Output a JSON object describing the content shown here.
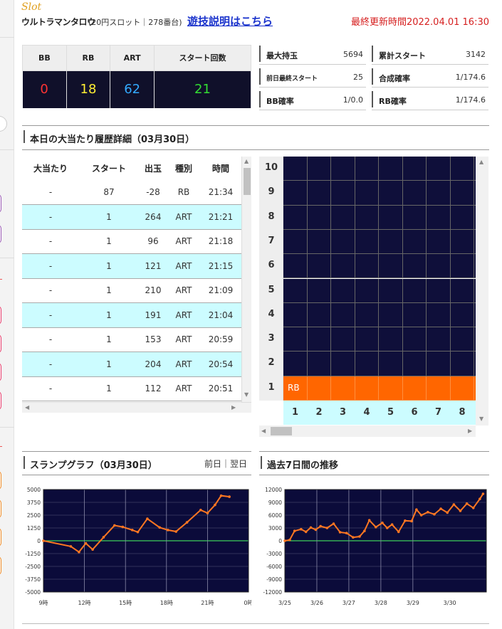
{
  "header": {
    "category": "Slot",
    "machine_name": "ウルトラマンタロウ",
    "subtitle": "(20円スロット｜278番台)",
    "rules_link": "遊技説明はこちら",
    "updated": "最終更新時間2022.04.01 16:30"
  },
  "counters": {
    "headers": [
      "BB",
      "RB",
      "ART",
      "スタート回数"
    ],
    "values": [
      "0",
      "18",
      "62",
      "21"
    ],
    "colors": [
      "#ff3333",
      "#ffee33",
      "#33aaff",
      "#33dd33"
    ]
  },
  "stats": [
    {
      "label": "最大持玉",
      "value": "5694"
    },
    {
      "label": "累計スタート",
      "value": "3142"
    },
    {
      "label": "前日最終スタート",
      "value": "25"
    },
    {
      "label": "合成確率",
      "value": "1/174.6"
    },
    {
      "label": "BB確率",
      "value": "1/0.0"
    },
    {
      "label": "RB確率",
      "value": "1/174.6"
    }
  ],
  "history": {
    "title": "本日の大当たり履歴詳細（03月30日）",
    "columns": [
      "大当たり",
      "スタート",
      "出玉",
      "種別",
      "時間"
    ],
    "rows": [
      [
        "-",
        "87",
        "-28",
        "RB",
        "21:34"
      ],
      [
        "-",
        "1",
        "264",
        "ART",
        "21:21"
      ],
      [
        "-",
        "1",
        "96",
        "ART",
        "21:18"
      ],
      [
        "-",
        "1",
        "121",
        "ART",
        "21:15"
      ],
      [
        "-",
        "1",
        "210",
        "ART",
        "21:09"
      ],
      [
        "-",
        "1",
        "191",
        "ART",
        "21:04"
      ],
      [
        "-",
        "1",
        "153",
        "ART",
        "20:59"
      ],
      [
        "-",
        "1",
        "204",
        "ART",
        "20:54"
      ],
      [
        "-",
        "1",
        "112",
        "ART",
        "20:51"
      ]
    ]
  },
  "hit_grid": {
    "y_labels": [
      "10",
      "9",
      "8",
      "7",
      "6",
      "5",
      "4",
      "3",
      "2",
      "1"
    ],
    "x_labels": [
      "1",
      "2",
      "3",
      "4",
      "5",
      "6",
      "7",
      "8"
    ],
    "hit_label": "RB",
    "hit_level": 1,
    "hit_color": "#ff6600",
    "cell_color": "#0f0f3a"
  },
  "slump": {
    "title": "スランプグラフ（03月30日）",
    "nav_prev": "前日",
    "nav_sep": "｜",
    "nav_next": "翌日"
  },
  "weekly": {
    "title": "過去7日間の推移"
  },
  "chart_data": [
    {
      "type": "line",
      "x_tick_labels": [
        "9時",
        "12時",
        "15時",
        "18時",
        "21時",
        "0時"
      ],
      "y_tick_labels": [
        "5000",
        "3750",
        "2500",
        "1250",
        "0",
        "-1250",
        "-2500",
        "-3750",
        "-5000"
      ],
      "ylim": [
        -5000,
        5000
      ],
      "xlim": [
        9,
        24
      ],
      "x": [
        9.0,
        11.0,
        11.6,
        12.1,
        12.6,
        13.4,
        14.2,
        14.8,
        15.5,
        15.9,
        16.6,
        17.5,
        18.1,
        18.7,
        19.5,
        20.5,
        21.0,
        21.55,
        22.0,
        22.6
      ],
      "y": [
        0,
        -550,
        -1100,
        -250,
        -850,
        350,
        1500,
        1350,
        1050,
        850,
        2150,
        1300,
        1050,
        900,
        1800,
        3000,
        2700,
        3500,
        4400,
        4300
      ],
      "line_color": "#ff7722",
      "grid": true
    },
    {
      "type": "line",
      "x_tick_labels": [
        "3/25",
        "3/26",
        "3/27",
        "3/28",
        "3/29",
        "3/30"
      ],
      "y_tick_labels": [
        "12000",
        "9000",
        "6000",
        "3000",
        "0",
        "-3000",
        "-6000",
        "-9000",
        "-12000"
      ],
      "ylim": [
        -12000,
        12000
      ],
      "xlim": [
        0,
        6.2
      ],
      "x": [
        0.0,
        0.15,
        0.3,
        0.5,
        0.65,
        0.8,
        0.95,
        1.1,
        1.3,
        1.5,
        1.7,
        1.9,
        2.1,
        2.3,
        2.45,
        2.6,
        2.8,
        3.0,
        3.15,
        3.3,
        3.5,
        3.7,
        3.9,
        4.05,
        4.2,
        4.4,
        4.6,
        4.8,
        5.0,
        5.2,
        5.4,
        5.6,
        5.8,
        6.0,
        6.1
      ],
      "y": [
        0,
        200,
        2300,
        2700,
        2100,
        3100,
        2600,
        3400,
        3000,
        4000,
        2000,
        1800,
        800,
        1000,
        2300,
        4800,
        3200,
        4200,
        3000,
        3800,
        2100,
        4700,
        4600,
        7300,
        6000,
        6700,
        6200,
        7500,
        6600,
        8500,
        7000,
        8700,
        7700,
        9800,
        11000
      ],
      "line_color": "#ff7722",
      "grid": true
    }
  ]
}
